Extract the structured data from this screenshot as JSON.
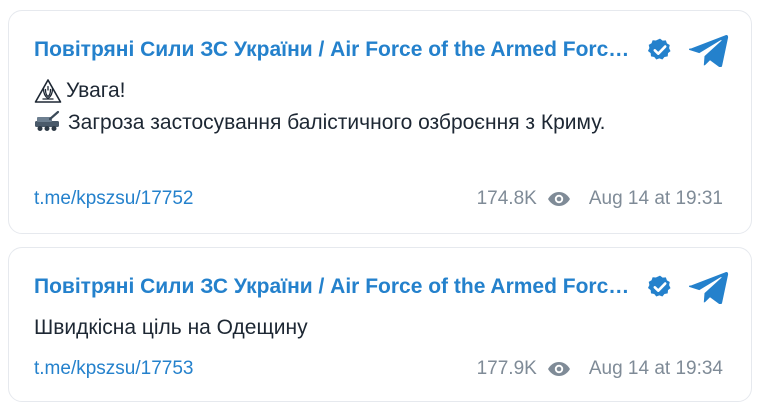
{
  "colors": {
    "accent": "#2481cc",
    "text": "#1d2733",
    "meta": "#7f8b97",
    "card_border": "#e6e9ee"
  },
  "posts": [
    {
      "channel": "Повітряні Сили ЗС України / Air Force of the Armed Forces of Ukraine",
      "icons": [
        "verified-badge-icon",
        "telegram-icon",
        "warning-emoji",
        "missile-emoji",
        "eye-icon"
      ],
      "line1": "Увага!",
      "line2": "Загроза застосування балістичного озброєння з Криму.",
      "link": "t.me/kpszsu/17752",
      "views": "174.8K",
      "date": "Aug 14 at 19:31"
    },
    {
      "channel": "Повітряні Сили ЗС України / Air Force of the Armed Forces of Ukraine",
      "icons": [
        "verified-badge-icon",
        "telegram-icon",
        "eye-icon"
      ],
      "text": "Швидкісна ціль на Одещину",
      "link": "t.me/kpszsu/17753",
      "views": "177.9K",
      "date": "Aug 14 at 19:34"
    }
  ]
}
